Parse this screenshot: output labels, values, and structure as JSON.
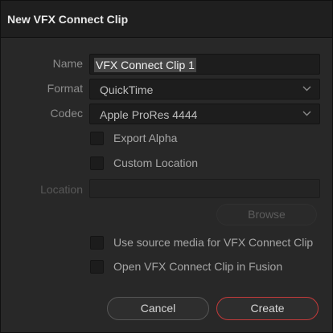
{
  "dialog": {
    "title": "New VFX Connect Clip"
  },
  "form": {
    "name_label": "Name",
    "name_value": "VFX Connect Clip 1",
    "format_label": "Format",
    "format_value": "QuickTime",
    "codec_label": "Codec",
    "codec_value": "Apple ProRes 4444",
    "export_alpha_label": "Export Alpha",
    "export_alpha_checked": false,
    "custom_location_label": "Custom Location",
    "custom_location_checked": false,
    "location_label": "Location",
    "location_value": "",
    "browse_label": "Browse",
    "use_source_media_label": "Use source media for VFX Connect Clip",
    "use_source_media_checked": false,
    "open_in_fusion_label": "Open VFX Connect Clip in Fusion",
    "open_in_fusion_checked": false
  },
  "actions": {
    "cancel_label": "Cancel",
    "create_label": "Create"
  },
  "colors": {
    "accent": "#c23a3a"
  },
  "icons": {
    "dropdown": "chevron-down-icon"
  }
}
